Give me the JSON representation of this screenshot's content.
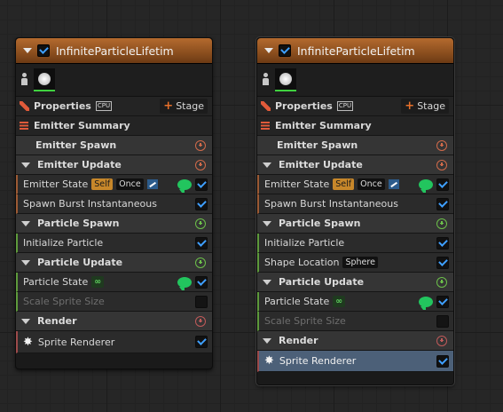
{
  "nodes": [
    {
      "title": "InfiniteParticleLifetim",
      "properties_label": "Properties",
      "cpu_label": "CPU",
      "stage_label": "Stage",
      "emitter_summary": "Emitter Summary",
      "sections": {
        "emitter_spawn": "Emitter Spawn",
        "emitter_update": "Emitter Update",
        "particle_spawn": "Particle Spawn",
        "particle_update": "Particle Update",
        "render": "Render"
      },
      "items": {
        "emitter_state": "Emitter State",
        "self_badge": "Self",
        "once_badge": "Once",
        "spawn_burst": "Spawn Burst Instantaneous",
        "initialize_particle": "Initialize Particle",
        "particle_state": "Particle State",
        "infinite_badge": "∞",
        "scale_sprite_size": "Scale Sprite Size",
        "sprite_renderer": "Sprite Renderer"
      }
    },
    {
      "title": "InfiniteParticleLifetim",
      "properties_label": "Properties",
      "cpu_label": "CPU",
      "stage_label": "Stage",
      "emitter_summary": "Emitter Summary",
      "sections": {
        "emitter_spawn": "Emitter Spawn",
        "emitter_update": "Emitter Update",
        "particle_spawn": "Particle Spawn",
        "particle_update": "Particle Update",
        "render": "Render"
      },
      "items": {
        "emitter_state": "Emitter State",
        "self_badge": "Self",
        "once_badge": "Once",
        "spawn_burst": "Spawn Burst Instantaneous",
        "initialize_particle": "Initialize Particle",
        "shape_location": "Shape Location",
        "sphere_badge": "Sphere",
        "particle_state": "Particle State",
        "infinite_badge": "∞",
        "scale_sprite_size": "Scale Sprite Size",
        "sprite_renderer": "Sprite Renderer"
      }
    }
  ]
}
